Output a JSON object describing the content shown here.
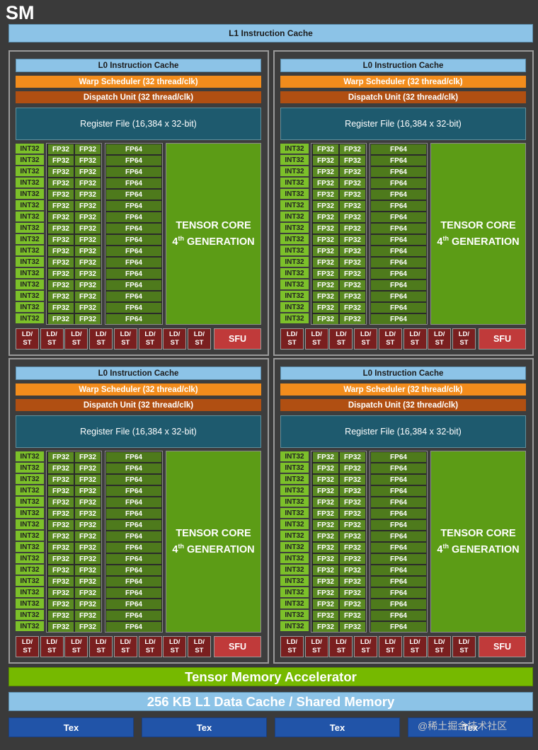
{
  "sm_title": "SM",
  "l1_instruction_cache": "L1 Instruction Cache",
  "partition": {
    "l0_cache": "L0 Instruction Cache",
    "warp_scheduler": "Warp Scheduler (32 thread/clk)",
    "dispatch_unit": "Dispatch Unit (32 thread/clk)",
    "register_file": "Register File (16,384 x 32-bit)",
    "int32_label": "INT32",
    "fp32_label": "FP32",
    "fp64_label": "FP64",
    "rows_per_column": 16,
    "tensor_core_line1": "TENSOR CORE",
    "tensor_core_ordinal": "4",
    "tensor_core_suffix": "th",
    "tensor_core_line2": "GENERATION",
    "ldst_top": "LD/",
    "ldst_bottom": "ST",
    "ldst_count": 8,
    "sfu": "SFU"
  },
  "partition_count": 4,
  "tensor_memory_accelerator": "Tensor Memory Accelerator",
  "l1_data_cache": "256 KB L1 Data Cache / Shared Memory",
  "tex_units": [
    "Tex",
    "Tex",
    "Tex",
    "Tex"
  ],
  "watermark": "@稀土掘金技术社区",
  "colors": {
    "background": "#3a3a3a",
    "cache_blue": "#8cc3e7",
    "warp_orange": "#f28c1c",
    "dispatch_brown": "#b04f12",
    "register_teal": "#1e5a6e",
    "int32_green": "#7cc02a",
    "fp32_green": "#5a8a22",
    "fp64_green": "#4e7a1c",
    "tensor_green": "#5c9c16",
    "ldst_red": "#7a1f1f",
    "sfu_red": "#c03a3a",
    "tma_green": "#76b900",
    "tex_blue": "#2154a8"
  }
}
